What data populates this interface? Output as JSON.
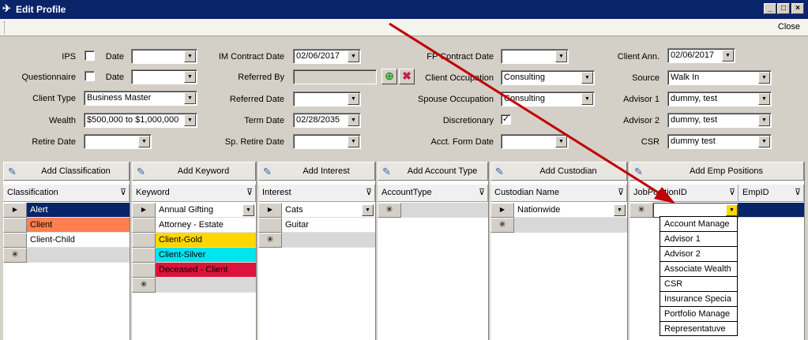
{
  "window": {
    "title": "Edit Profile",
    "close_label": "Close"
  },
  "colors": {
    "titlebar": "#0a246a",
    "selected_row": "#0a246a",
    "client": "#ff7f50",
    "client_gold": "#ffd700",
    "client_silver": "#00e5ee",
    "deceased": "#dc143c",
    "arrow": "#c00000"
  },
  "form": {
    "ips": {
      "label": "IPS",
      "date_label": "Date",
      "date_value": ""
    },
    "questionnaire": {
      "label": "Questionnaire",
      "date_label": "Date",
      "date_value": ""
    },
    "client_type": {
      "label": "Client Type",
      "value": "Business Master"
    },
    "wealth": {
      "label": "Wealth",
      "value": "$500,000 to $1,000,000"
    },
    "retire_date": {
      "label": "Retire Date",
      "value": ""
    },
    "im_contract_date": {
      "label": "IM Contract Date",
      "value": "02/06/2017"
    },
    "referred_by": {
      "label": "Referred By",
      "value": ""
    },
    "referred_date": {
      "label": "Referred Date",
      "value": ""
    },
    "term_date": {
      "label": "Term Date",
      "value": "02/28/2035"
    },
    "sp_retire_date": {
      "label": "Sp. Retire Date",
      "value": ""
    },
    "fp_contract_date": {
      "label": "FP Contract Date",
      "value": ""
    },
    "client_occupation": {
      "label": "Client Occupation",
      "value": "Consulting"
    },
    "spouse_occupation": {
      "label": "Spouse Occupation",
      "value": "Consulting"
    },
    "discretionary": {
      "label": "Discretionary",
      "checked": true,
      "mark": "✓"
    },
    "acct_form_date": {
      "label": "Acct. Form Date",
      "value": ""
    },
    "client_ann": {
      "label": "Client Ann.",
      "value": "02/06/2017"
    },
    "source": {
      "label": "Source",
      "value": "Walk In"
    },
    "advisor1": {
      "label": "Advisor 1",
      "value": "dummy, test"
    },
    "advisor2": {
      "label": "Advisor 2",
      "value": "dummy, test"
    },
    "csr": {
      "label": "CSR",
      "value": "dummy test"
    }
  },
  "grids": {
    "classification": {
      "button": "Add Classification",
      "column": "Classification",
      "rows": [
        "Alert",
        "Client",
        "Client-Child"
      ]
    },
    "keyword": {
      "button": "Add Keyword",
      "column": "Keyword",
      "rows": [
        "Annual Gifting",
        "Attorney - Estate",
        "Client-Gold",
        "Client-Silver",
        "Deceased - Client"
      ]
    },
    "interest": {
      "button": "Add Interest",
      "column": "Interest",
      "rows": [
        "Cats",
        "Guitar"
      ]
    },
    "account_type": {
      "button": "Add Account Type",
      "column": "AccountType",
      "rows": []
    },
    "custodian": {
      "button": "Add Custodian",
      "column": "Custodian Name",
      "rows": [
        "Nationwide"
      ]
    },
    "emp_positions": {
      "button": "Add Emp Positions",
      "column1": "JobPositionID",
      "column2": "EmpID",
      "rows": []
    }
  },
  "dropdown_options": [
    "Account Manage",
    "Advisor 1",
    "Advisor 2",
    "Associate Wealth",
    "CSR",
    "Insurance Specia",
    "Portfolio Manage",
    "Representatuve"
  ],
  "glyphs": {
    "new_row": "✳",
    "current_row": "▶",
    "filter": "⊽",
    "combo_arrow": "▼"
  }
}
